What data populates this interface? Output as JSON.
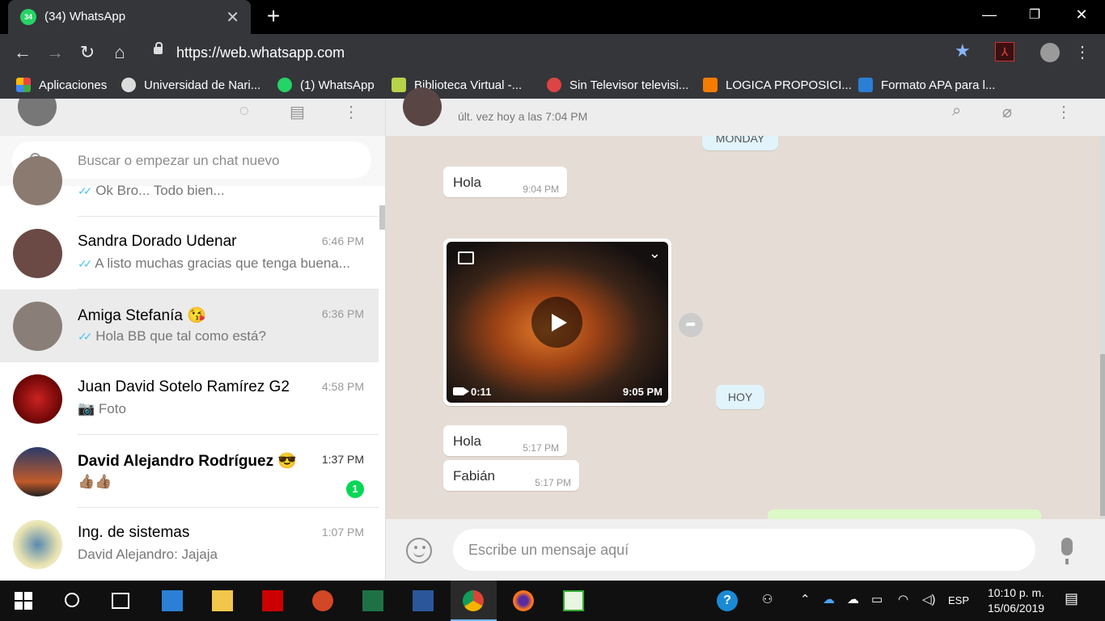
{
  "browser": {
    "tab_title": "(34) WhatsApp",
    "tab_badge": "34",
    "url": "https://web.whatsapp.com",
    "bookmarks": [
      {
        "label": "Aplicaciones",
        "color": "#e44"
      },
      {
        "label": "Universidad de Nari...",
        "color": "#ddd"
      },
      {
        "label": "(1) WhatsApp",
        "color": "#25d366"
      },
      {
        "label": "Biblioteca Virtual -...",
        "color": "#b8d24a"
      },
      {
        "label": "Sin Televisor televisi...",
        "color": "#d44"
      },
      {
        "label": "LOGICA PROPOSICI...",
        "color": "#f57c00"
      },
      {
        "label": "Formato APA para l...",
        "color": "#2a7fd4"
      }
    ]
  },
  "sidebar": {
    "search_placeholder": "Buscar o empezar un chat nuevo",
    "chats": [
      {
        "name": "",
        "time": "",
        "message": "Ok Bro... Todo bien...",
        "ticks": "✓✓",
        "avatar_color": "#8a7a70"
      },
      {
        "name": "Sandra Dorado Udenar",
        "time": "6:46 PM",
        "message": "A listo muchas gracias que tenga buena...",
        "ticks": "✓✓",
        "avatar_color": "#6b4a45"
      },
      {
        "name": "Amiga Stefanía 😘",
        "time": "6:36 PM",
        "message": "Hola BB que tal como está?",
        "ticks": "✓✓",
        "avatar_color": "#8a7f78"
      },
      {
        "name": "Juan David Sotelo Ramírez G2",
        "time": "4:58 PM",
        "message": "Foto",
        "ticks": "📷",
        "avatar_color": "#8b0b0b"
      },
      {
        "name": "David Alejandro Rodríguez 😎",
        "time": "1:37 PM",
        "message": "👍🏽👍🏽",
        "ticks": "",
        "avatar_color": "#2a3b6a",
        "unread": "1"
      },
      {
        "name": "Ing. de sistemas",
        "time": "1:07 PM",
        "message": "David Alejandro: Jajaja",
        "ticks": "",
        "avatar_color": "#e8e2b0"
      }
    ]
  },
  "conversation": {
    "last_seen": "últ. vez hoy a las 7:04 PM",
    "day_monday": "MONDAY",
    "day_today": "HOY",
    "messages": [
      {
        "text": "Hola",
        "time": "9:04 PM"
      },
      {
        "text": "Hola",
        "time": "5:17 PM"
      },
      {
        "text": "Fabián",
        "time": "5:17 PM"
      }
    ],
    "video": {
      "duration": "0:11",
      "time": "9:05 PM"
    },
    "compose_placeholder": "Escribe un mensaje aquí"
  },
  "taskbar": {
    "language": "ESP",
    "time": "10:10 p. m.",
    "date": "15/06/2019"
  }
}
